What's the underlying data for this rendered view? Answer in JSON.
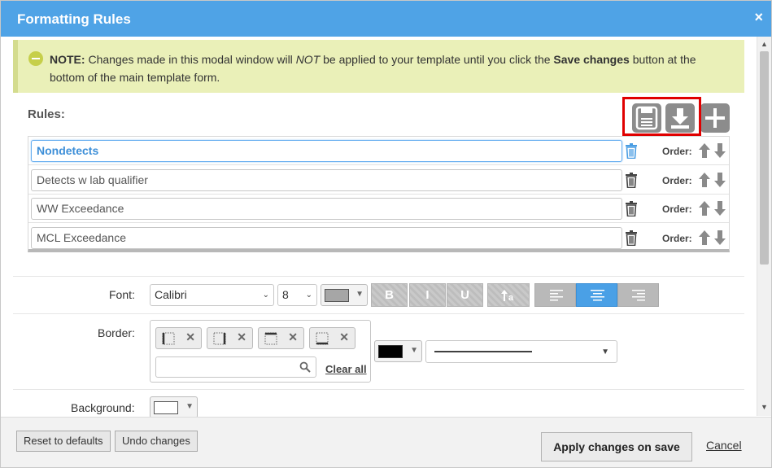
{
  "dialog": {
    "title": "Formatting Rules",
    "close_glyph": "×"
  },
  "note": {
    "prefix": "NOTE:",
    "text_1": " Changes made in this modal window will ",
    "emphasis": "NOT",
    "text_2": " be applied to your template until you click the ",
    "strong": "Save changes",
    "text_3": " button at the bottom of the main template form."
  },
  "rules": {
    "label": "Rules:",
    "order_label": "Order:",
    "items": [
      {
        "name": "Nondetects",
        "selected": true
      },
      {
        "name": "Detects w lab qualifier",
        "selected": false
      },
      {
        "name": "WW Exceedance",
        "selected": false
      },
      {
        "name": "MCL Exceedance",
        "selected": false
      }
    ],
    "toolbar_icons": [
      "save-icon",
      "download-icon",
      "plus-icon"
    ]
  },
  "font": {
    "label": "Font:",
    "family": "Calibri",
    "size": "8",
    "color": "#a6a6a6",
    "bold_label": "B",
    "italic_label": "I",
    "underline_label": "U"
  },
  "border": {
    "label": "Border:",
    "clear_all": "Clear all",
    "line_color": "#000000"
  },
  "background": {
    "label": "Background:",
    "color": "#ffffff"
  },
  "footer": {
    "reset": "Reset to defaults",
    "undo": "Undo changes",
    "apply": "Apply changes on save",
    "cancel": "Cancel"
  }
}
